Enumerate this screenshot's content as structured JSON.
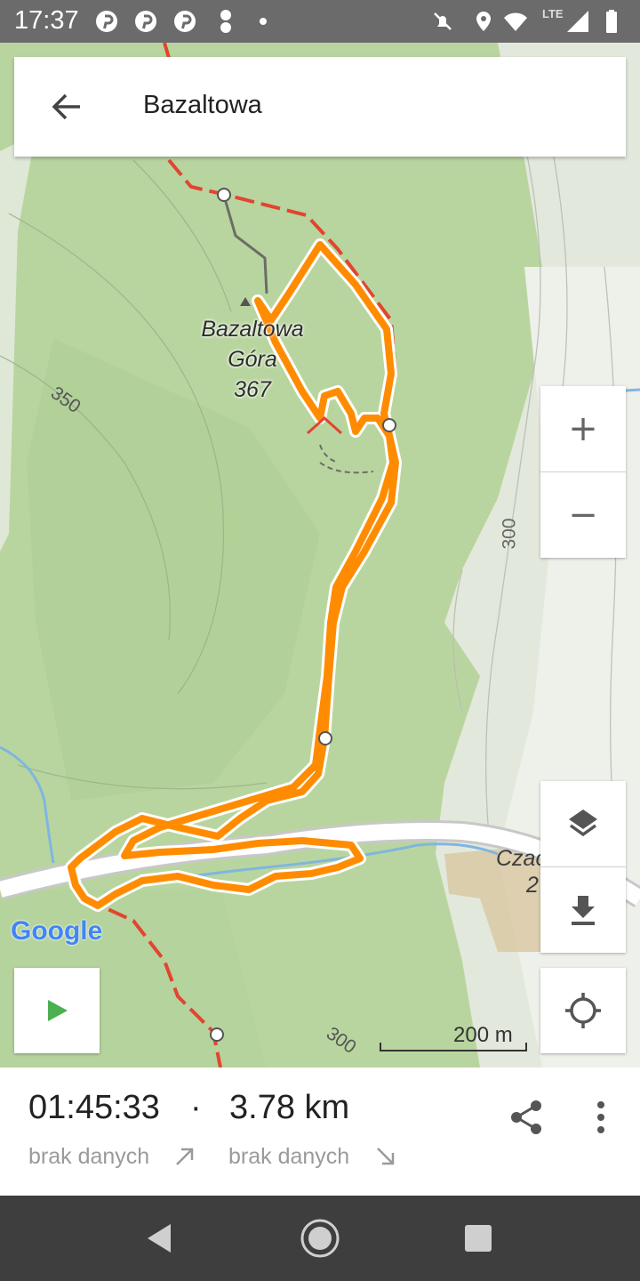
{
  "status_bar": {
    "time": "17:37",
    "network_label": "LTE",
    "icons": [
      "pinterest-icon",
      "pinterest-icon",
      "pinterest-icon",
      "hourglass-icon",
      "dot-icon",
      "mute-icon",
      "location-icon",
      "wifi-icon",
      "signal-icon",
      "battery-icon"
    ]
  },
  "header": {
    "title": "Bazaltowa",
    "back_icon": "arrow-back-icon"
  },
  "map": {
    "peak_name_line1": "Bazaltowa",
    "peak_name_line2": "Góra",
    "peak_elevation": "367",
    "contour_labels": [
      "350",
      "300",
      "300"
    ],
    "place_label": "Czac",
    "place_label_suffix": "2",
    "scale_label": "200 m",
    "attribution": "Google",
    "route_color": "#ff8c00",
    "trail_color": "#e2452f"
  },
  "controls": {
    "zoom_in": "+",
    "zoom_out": "−",
    "layers_icon": "layers-icon",
    "download_icon": "download-icon",
    "locate_icon": "my-location-icon",
    "play_icon": "play-icon"
  },
  "track_info": {
    "duration": "01:45:33",
    "separator": "·",
    "distance": "3.78 km",
    "ascent_label": "brak danych",
    "descent_label": "brak danych",
    "share_icon": "share-icon",
    "more_icon": "more-vert-icon"
  },
  "nav_bar": {
    "icons": [
      "back-triangle-icon",
      "home-circle-icon",
      "recents-square-icon"
    ]
  }
}
